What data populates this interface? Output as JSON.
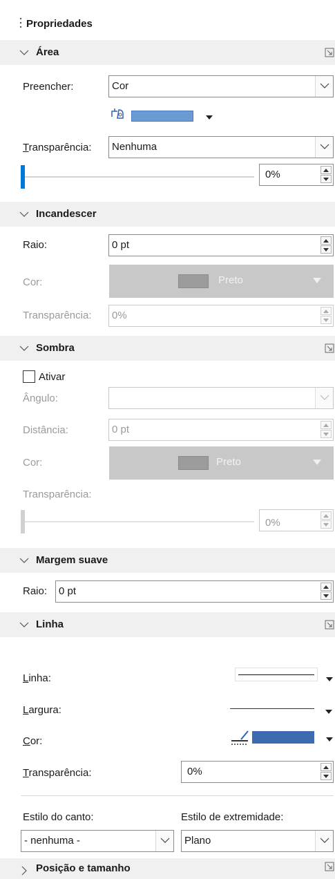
{
  "panel": {
    "title": "Propriedades"
  },
  "area": {
    "title": "Área",
    "fill_label": "Preencher:",
    "fill_value": "Cor",
    "fill_color": "#6b9bd2",
    "transparency_label": "Transparência:",
    "transparency_value": "Nenhuma",
    "transparency_percent": "0%",
    "slider_level": 0
  },
  "glow": {
    "title": "Incandescer",
    "radius_label": "Raio:",
    "radius_value": "0 pt",
    "color_label": "Cor:",
    "color_name": "Preto",
    "transparency_label": "Transparência:",
    "transparency_value": "0%"
  },
  "shadow": {
    "title": "Sombra",
    "enable_label": "Ativar",
    "enabled": false,
    "angle_label": "Ângulo:",
    "angle_value": "",
    "distance_label": "Distância:",
    "distance_value": "0 pt",
    "color_label": "Cor:",
    "color_name": "Preto",
    "transparency_label": "Transparência:",
    "transparency_value": "0%"
  },
  "soft_edge": {
    "title": "Margem suave",
    "radius_label": "Raio:",
    "radius_value": "0 pt"
  },
  "line": {
    "title": "Linha",
    "line_label": "Linha:",
    "width_label": "Largura:",
    "color_label": "Cor:",
    "line_color": "#3c6bb0",
    "transparency_label": "Transparência:",
    "transparency_value": "0%",
    "corner_style_label": "Estilo do canto:",
    "corner_style_value": "- nenhuma -",
    "cap_style_label": "Estilo de extremidade:",
    "cap_style_value": "Plano"
  },
  "position": {
    "title": "Posição e tamanho"
  },
  "colors": {
    "accent": "#0078d7",
    "header_bg": "#f0f0f0",
    "disabled_fill": "#c8c8c8"
  }
}
